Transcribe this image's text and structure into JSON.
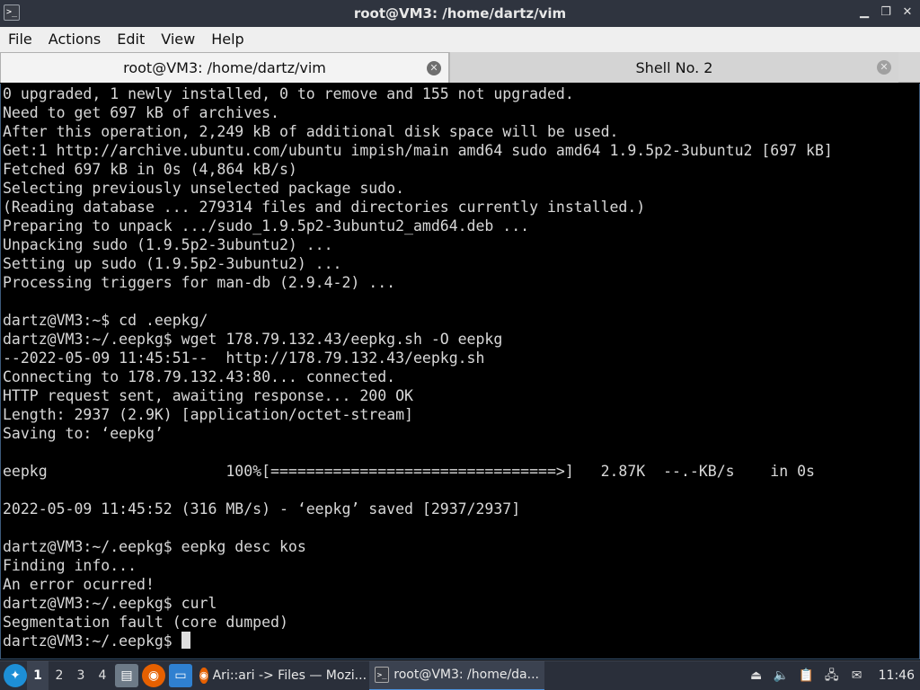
{
  "window": {
    "title": "root@VM3: /home/dartz/vim",
    "icon": "terminal-icon",
    "controls": [
      "minimize-icon",
      "restore-icon",
      "close-icon"
    ]
  },
  "menubar": {
    "items": [
      "File",
      "Actions",
      "Edit",
      "View",
      "Help"
    ]
  },
  "tabs": [
    {
      "label": "root@VM3: /home/dartz/vim",
      "active": true
    },
    {
      "label": "Shell No. 2",
      "active": false
    }
  ],
  "terminal": {
    "lines": [
      "0 upgraded, 1 newly installed, 0 to remove and 155 not upgraded.",
      "Need to get 697 kB of archives.",
      "After this operation, 2,249 kB of additional disk space will be used.",
      "Get:1 http://archive.ubuntu.com/ubuntu impish/main amd64 sudo amd64 1.9.5p2-3ubuntu2 [697 kB]",
      "Fetched 697 kB in 0s (4,864 kB/s)",
      "Selecting previously unselected package sudo.",
      "(Reading database ... 279314 files and directories currently installed.)",
      "Preparing to unpack .../sudo_1.9.5p2-3ubuntu2_amd64.deb ...",
      "Unpacking sudo (1.9.5p2-3ubuntu2) ...",
      "Setting up sudo (1.9.5p2-3ubuntu2) ...",
      "Processing triggers for man-db (2.9.4-2) ...",
      "",
      "dartz@VM3:~$ cd .eepkg/",
      "dartz@VM3:~/.eepkg$ wget 178.79.132.43/eepkg.sh -O eepkg",
      "--2022-05-09 11:45:51--  http://178.79.132.43/eepkg.sh",
      "Connecting to 178.79.132.43:80... connected.",
      "HTTP request sent, awaiting response... 200 OK",
      "Length: 2937 (2.9K) [application/octet-stream]",
      "Saving to: ‘eepkg’",
      "",
      "eepkg                    100%[================================>]   2.87K  --.-KB/s    in 0s",
      "",
      "2022-05-09 11:45:52 (316 MB/s) - ‘eepkg’ saved [2937/2937]",
      "",
      "dartz@VM3:~/.eepkg$ eepkg desc kos",
      "Finding info...",
      "An error ocurred!",
      "dartz@VM3:~/.eepkg$ curl",
      "Segmentation fault (core dumped)"
    ],
    "prompt": "dartz@VM3:~/.eepkg$ "
  },
  "taskbar": {
    "start_icon": "start-menu-icon",
    "workspaces": [
      "1",
      "2",
      "3",
      "4"
    ],
    "active_workspace": "1",
    "launchers": [
      "file-manager-icon",
      "firefox-icon",
      "show-desktop-icon"
    ],
    "tasks": [
      {
        "label": "Ari::ari -> Files — Mozi...",
        "icon": "firefox-icon",
        "active": false
      },
      {
        "label": "root@VM3: /home/da...",
        "icon": "terminal-icon",
        "active": true
      }
    ],
    "tray_icons": [
      "removable-media-icon",
      "volume-icon",
      "clipboard-icon",
      "network-icon",
      "notifications-icon"
    ],
    "clock": "11:46"
  }
}
